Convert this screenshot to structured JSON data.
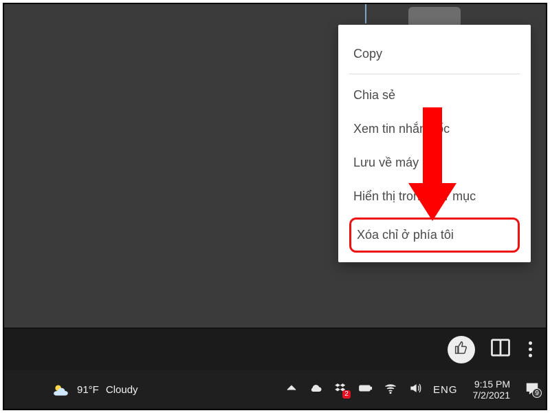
{
  "context_menu": {
    "items": [
      {
        "label": "Copy"
      },
      {
        "label": "Chia sẻ"
      },
      {
        "label": "Xem tin nhắn gốc"
      },
      {
        "label": "Lưu về máy"
      },
      {
        "label": "Hiển thị trong thư mục"
      },
      {
        "label": "Xóa chỉ ở phía tôi"
      }
    ]
  },
  "taskbar": {
    "weather": {
      "temp": "91°F",
      "condition": "Cloudy"
    },
    "dropbox_badge": "2",
    "language": "ENG",
    "clock": {
      "time": "9:15 PM",
      "date": "7/2/2021"
    },
    "action_center_count": "9"
  }
}
